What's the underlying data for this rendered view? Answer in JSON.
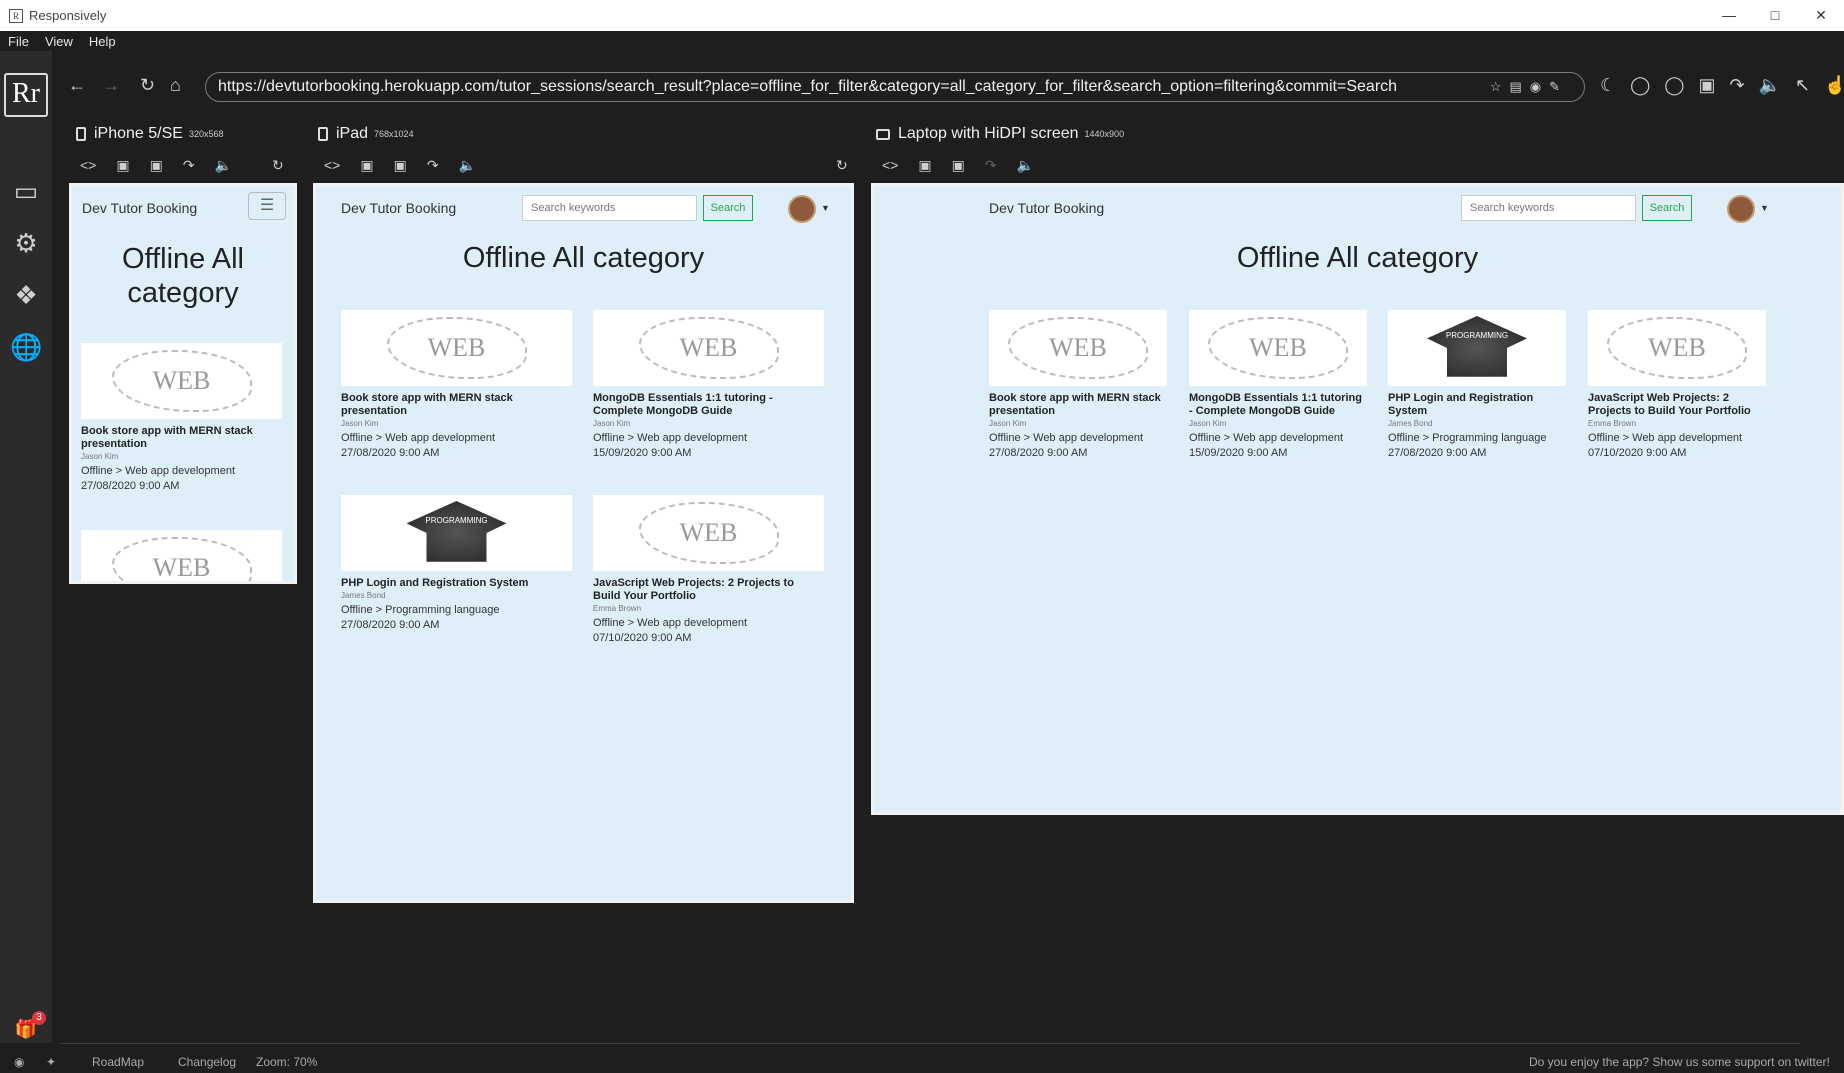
{
  "window": {
    "title": "Responsively",
    "icon_name": "responsively-app-icon"
  },
  "menu": {
    "items": [
      "File",
      "View",
      "Help"
    ]
  },
  "sidebar": {
    "logo": "Rr",
    "icons": [
      "devices-icon",
      "gear-icon",
      "puzzle-icon",
      "globe-icon"
    ],
    "gift_badge": "3"
  },
  "toolbar": {
    "url": "https://devtutorbooking.herokuapp.com/tutor_sessions/search_result?place=offline_for_filter&category=all_category_for_filter&search_option=filtering&commit=Search"
  },
  "devices": [
    {
      "name": "iPhone 5/SE",
      "res": "320x568"
    },
    {
      "name": "iPad",
      "res": "768x1024"
    },
    {
      "name": "Laptop with HiDPI screen",
      "res": "1440x900"
    }
  ],
  "site": {
    "brand": "Dev Tutor Booking",
    "search_placeholder": "Search keywords",
    "search_button": "Search",
    "page_title": "Offline All category",
    "mobile_title_line1": "Offline All",
    "mobile_title_line2": "category"
  },
  "sessions": [
    {
      "title": "Book store app with MERN stack presentation",
      "author": "Jason Kim",
      "category": "Offline > Web app development",
      "date": "27/08/2020 9:00 AM",
      "image": "web-app-whale"
    },
    {
      "title": "MongoDB Essentials 1:1 tutoring - Complete MongoDB Guide",
      "author": "Jason Kim",
      "category": "Offline > Web app development",
      "date": "15/09/2020 9:00 AM",
      "image": "web-app-whale"
    },
    {
      "title": "PHP Login and Registration System",
      "author": "James Bond",
      "category": "Offline > Programming language",
      "date": "27/08/2020 9:00 AM",
      "image": "programming-cap"
    },
    {
      "title": "JavaScript Web Projects: 2 Projects to Build Your Portfolio",
      "author": "Emma Brown",
      "category": "Offline > Web app development",
      "date": "07/10/2020 9:00 AM",
      "image": "web-app-whale"
    }
  ],
  "status": {
    "roadmap": "RoadMap",
    "changelog": "Changelog",
    "zoom": "Zoom: 70%",
    "support": "Do you enjoy the app? Show us some support on twitter!"
  }
}
